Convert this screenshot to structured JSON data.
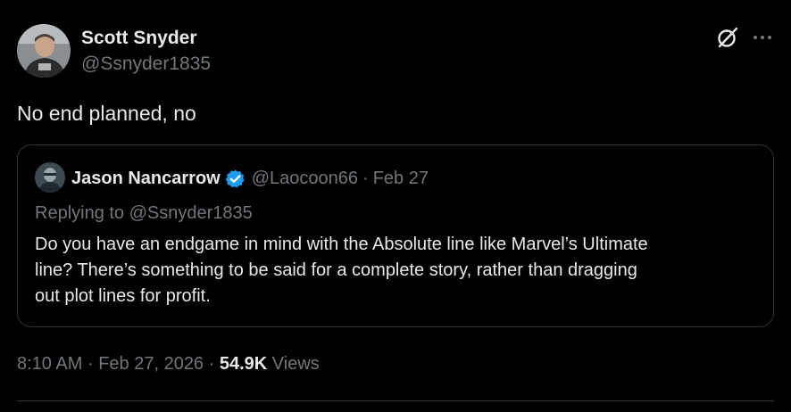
{
  "tweet": {
    "author_name": "Scott Snyder",
    "author_handle": "@Ssnyder1835",
    "text": "No end planned, no",
    "time": "8:10 AM",
    "date": "Feb 27, 2026",
    "views_count": "54.9K",
    "views_label": "Views",
    "separator": "·"
  },
  "quote": {
    "author_name": "Jason Nancarrow",
    "author_handle": "@Laocoon66",
    "separator": "·",
    "date": "Feb 27",
    "reply_prefix": "Replying to",
    "reply_to": "@Ssnyder1835",
    "text_lines": [
      "Do you have an endgame in mind with the Absolute line like Marvel’s Ultimate",
      "line? There’s something to be said for a complete story, rather than dragging",
      "out plot lines for profit."
    ]
  },
  "icons": {
    "grok": "grok-icon",
    "more": "more-icon",
    "verified": "verified-badge-icon"
  },
  "colors": {
    "background": "#000000",
    "primary_text": "#e7e9ea",
    "secondary_text": "#71767b",
    "border": "#2f3336",
    "verified_blue": "#1d9bf0"
  }
}
